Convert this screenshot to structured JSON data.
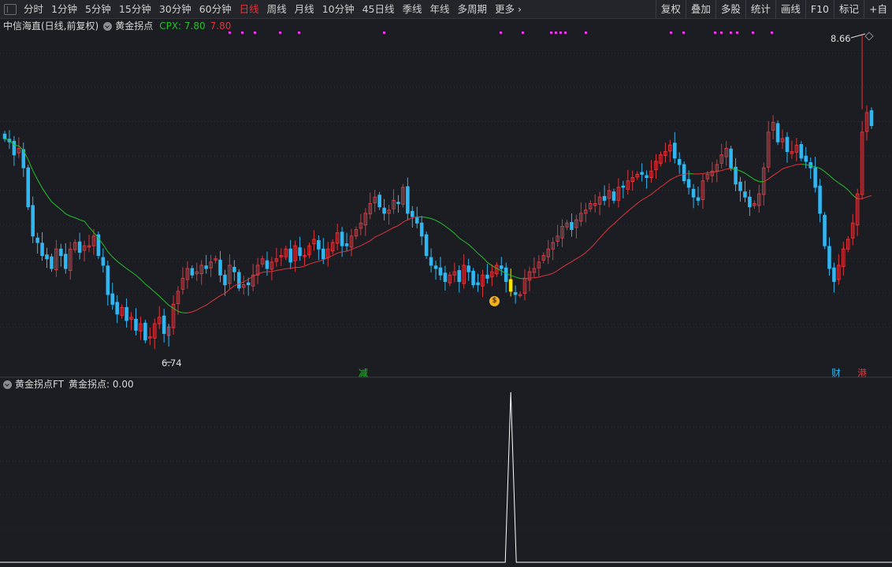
{
  "toolbar": {
    "periods": [
      "分时",
      "1分钟",
      "5分钟",
      "15分钟",
      "30分钟",
      "60分钟",
      "日线",
      "周线",
      "月线",
      "10分钟",
      "45日线",
      "季线",
      "年线",
      "多周期",
      "更多"
    ],
    "active_index": 6,
    "tools": [
      "复权",
      "叠加",
      "多股",
      "统计",
      "画线",
      "F10",
      "标记",
      "+自"
    ]
  },
  "main_panel": {
    "symbol_label": "中信海直(日线,前复权)",
    "indicator_name": "黄金拐点",
    "cpx_label": "CPX: 7.80",
    "cpx_value2": "7.80",
    "high_label": "8.66",
    "low_label": "6.74",
    "signal_tags": {
      "jian": "减",
      "cai": "财",
      "gang": "港"
    }
  },
  "sub_panel": {
    "indicator_label": "黄金拐点FT",
    "value_label": "黄金拐点: 0.00"
  },
  "colors": {
    "up": "#e0353b",
    "down": "#31b6f1",
    "ma_up": "#e0353b",
    "ma_down": "#22c22a",
    "signal_candle": "#f5e400",
    "grid": "#2c2f36",
    "marker_dots": "#e040e0"
  },
  "chart_data": {
    "type": "candlestick",
    "y_range": [
      6.74,
      8.66
    ],
    "closes": [
      8.02,
      8.0,
      7.92,
      7.96,
      7.84,
      7.6,
      7.42,
      7.38,
      7.3,
      7.28,
      7.22,
      7.34,
      7.3,
      7.22,
      7.34,
      7.38,
      7.32,
      7.36,
      7.36,
      7.42,
      7.3,
      7.24,
      7.06,
      7.0,
      6.94,
      6.98,
      6.9,
      6.92,
      6.84,
      6.88,
      6.78,
      6.8,
      6.88,
      6.92,
      6.82,
      6.86,
      7.0,
      7.08,
      7.16,
      7.22,
      7.18,
      7.2,
      7.24,
      7.22,
      7.26,
      7.28,
      7.18,
      7.12,
      7.24,
      7.2,
      7.1,
      7.12,
      7.12,
      7.18,
      7.24,
      7.28,
      7.22,
      7.26,
      7.28,
      7.3,
      7.34,
      7.26,
      7.36,
      7.3,
      7.3,
      7.36,
      7.4,
      7.34,
      7.28,
      7.34,
      7.38,
      7.44,
      7.36,
      7.36,
      7.42,
      7.46,
      7.5,
      7.56,
      7.62,
      7.66,
      7.6,
      7.56,
      7.58,
      7.64,
      7.62,
      7.72,
      7.56,
      7.54,
      7.5,
      7.42,
      7.3,
      7.24,
      7.22,
      7.18,
      7.14,
      7.18,
      7.2,
      7.14,
      7.24,
      7.2,
      7.12,
      7.12,
      7.18,
      7.16,
      7.2,
      7.24,
      7.22,
      7.14,
      7.08,
      7.06,
      7.06,
      7.16,
      7.2,
      7.22,
      7.26,
      7.3,
      7.34,
      7.38,
      7.42,
      7.48,
      7.5,
      7.46,
      7.52,
      7.56,
      7.58,
      7.62,
      7.62,
      7.66,
      7.64,
      7.7,
      7.64,
      7.72,
      7.72,
      7.76,
      7.78,
      7.8,
      7.8,
      7.78,
      7.82,
      7.88,
      7.92,
      7.94,
      7.98,
      7.9,
      7.86,
      7.76,
      7.72,
      7.66,
      7.64,
      7.76,
      7.8,
      7.82,
      7.86,
      7.92,
      7.96,
      7.84,
      7.74,
      7.7,
      7.66,
      7.6,
      7.62,
      7.68,
      7.84,
      8.06,
      8.12,
      8.0,
      8.02,
      7.94,
      7.94,
      7.98,
      7.9,
      7.88,
      7.84,
      7.72,
      7.56,
      7.36,
      7.22,
      7.14,
      7.24,
      7.34,
      7.4,
      7.5,
      7.68,
      8.06,
      8.18,
      8.1
    ],
    "annotations": [
      {
        "label": "6.74",
        "role": "low"
      },
      {
        "label": "8.66",
        "role": "high"
      }
    ],
    "sub_indicator": {
      "name": "黄金拐点",
      "values_note": "single spike at signal candle",
      "spike_index": 108,
      "spike_value": 1.0
    }
  }
}
